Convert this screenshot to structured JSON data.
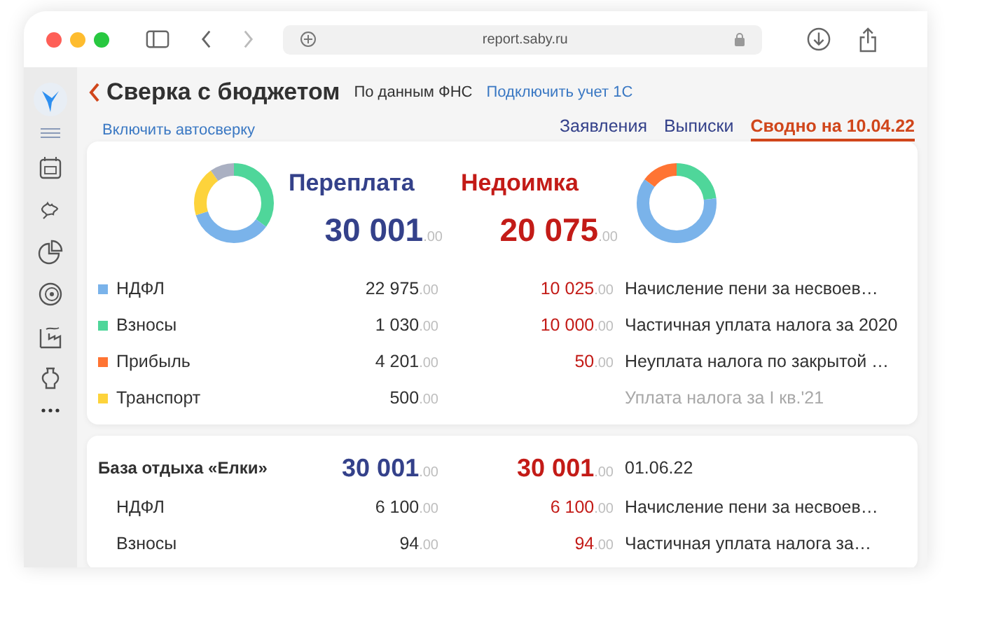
{
  "browser": {
    "url": "report.saby.ru"
  },
  "header": {
    "title": "Сверка с бюджетом",
    "source": "По данным ФНС",
    "link": "Подключить учет 1С"
  },
  "autocheck_link": "Включить автосверку",
  "tabs": [
    {
      "label": "Заявления",
      "selected": false
    },
    {
      "label": "Выписки",
      "selected": false
    },
    {
      "label": "Сводно на 10.04.22",
      "selected": true
    }
  ],
  "summary": {
    "overpay_title": "Переплата",
    "overpay_amount": "30 001",
    "overpay_cents": ".00",
    "debt_title": "Недоимка",
    "debt_amount": "20 075",
    "debt_cents": ".00",
    "rows": [
      {
        "label": "НДФЛ",
        "color": "#7ab3ea",
        "overpay": "22 975",
        "overpay_cents": ".00",
        "debt": "10 025",
        "debt_cents": ".00",
        "description": "Начисление пени за несвоев…",
        "muted": false
      },
      {
        "label": "Взносы",
        "color": "#4fd69a",
        "overpay": "1 030",
        "overpay_cents": ".00",
        "debt": "10 000",
        "debt_cents": ".00",
        "description": "Частичная уплата налога за 2020",
        "muted": false
      },
      {
        "label": "Прибыль",
        "color": "#ff7433",
        "overpay": "4 201",
        "overpay_cents": ".00",
        "debt": "50",
        "debt_cents": ".00",
        "description": "Неуплата налога по закрытой …",
        "muted": false
      },
      {
        "label": "Транспорт",
        "color": "#fdd33b",
        "overpay": "500",
        "overpay_cents": ".00",
        "description": "Уплата налога за I кв.'21",
        "muted": true
      }
    ]
  },
  "org": {
    "name": "База отдыха «Елки»",
    "overpay": "30 001",
    "overpay_cents": ".00",
    "debt": "30 001",
    "debt_cents": ".00",
    "date": "01.06.22",
    "rows": [
      {
        "label": "НДФЛ",
        "overpay": "6 100",
        "overpay_cents": ".00",
        "debt": "6 100",
        "debt_cents": ".00",
        "description": "Начисление пени за несвоев…"
      },
      {
        "label": "Взносы",
        "overpay": "94",
        "overpay_cents": ".00",
        "debt": "94",
        "debt_cents": ".00",
        "description": "Частичная уплата налога за…"
      }
    ]
  }
}
